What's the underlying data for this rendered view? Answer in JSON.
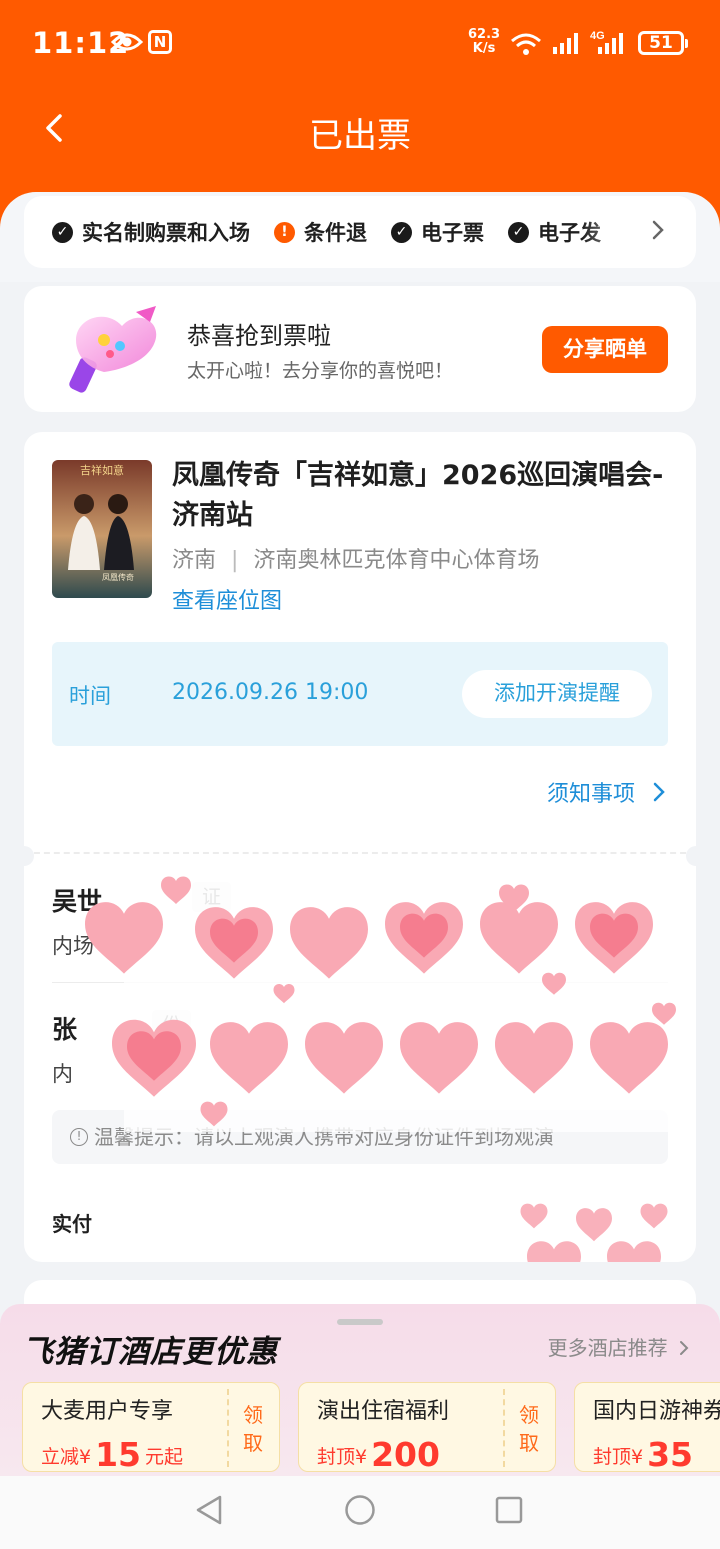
{
  "status_bar": {
    "time": "11:12",
    "net_speed_value": "62.3",
    "net_speed_unit": "K/s",
    "network": "4G",
    "battery": "51"
  },
  "nav": {
    "title": "已出票"
  },
  "tags": [
    {
      "label": "实名制购票和入场",
      "icon": "check-circle-icon"
    },
    {
      "label": "条件退",
      "icon": "warning-circle-icon"
    },
    {
      "label": "电子票",
      "icon": "check-circle-icon"
    },
    {
      "label": "电子发",
      "icon": "check-circle-icon"
    }
  ],
  "congrats": {
    "title": "恭喜抢到票啦",
    "subtitle": "太开心啦！去分享你的喜悦吧！",
    "share_button": "分享晒单"
  },
  "show": {
    "title": "凤凰传奇「吉祥如意」2026巡回演唱会-济南站",
    "city": "济南",
    "separator": "|",
    "venue": "济南奥林匹克体育中心体育场",
    "seat_link": "查看座位图",
    "poster_title": "吉祥如意",
    "poster_name": "凤凰传奇",
    "time_label": "时间",
    "time_value": "2026.09.26 19:00",
    "remind_button": "添加开演提醒",
    "notice_link": "须知事项"
  },
  "attendees": [
    {
      "name": "吴世",
      "id_badge": "证",
      "zone": "内场"
    },
    {
      "name": "张",
      "id_badge": "份证",
      "zone": "内"
    }
  ],
  "tip": "温馨提示：请以上观演人携带对应身份证件到场观演",
  "payment_label": "实付",
  "hotel": {
    "title": "飞猪订酒店更优惠",
    "more": "更多酒店推荐",
    "coupons": [
      {
        "title": "大麦用户专享",
        "prefix": "立减¥",
        "amount": "15",
        "suffix": "元起",
        "action": "领取"
      },
      {
        "title": "演出住宿福利",
        "prefix": "封顶¥",
        "amount": "200",
        "suffix": "",
        "action": "领取"
      },
      {
        "title": "国内日游神券",
        "prefix": "封顶¥",
        "amount": "35",
        "suffix": "",
        "action": "领取"
      }
    ]
  },
  "colors": {
    "brand_orange": "#ff5a00",
    "link_blue": "#1e8ed8",
    "time_blue": "#2aa0da",
    "coupon_red": "#ff3a2e"
  }
}
